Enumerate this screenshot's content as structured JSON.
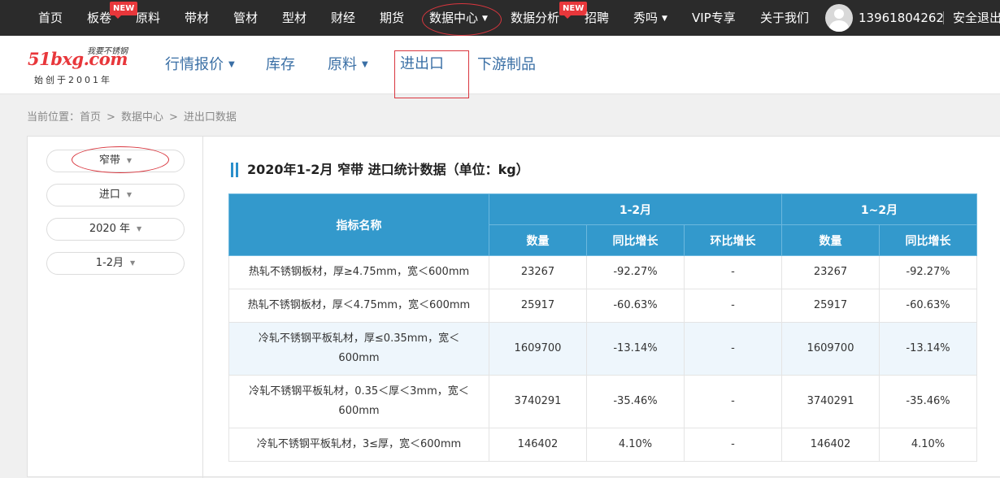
{
  "topnav": {
    "items": [
      {
        "label": "首页"
      },
      {
        "label": "板卷",
        "badge": "NEW"
      },
      {
        "label": "原料"
      },
      {
        "label": "带材"
      },
      {
        "label": "管材"
      },
      {
        "label": "型材"
      },
      {
        "label": "财经"
      },
      {
        "label": "期货"
      },
      {
        "label": "数据中心"
      },
      {
        "label": "数据分析",
        "badge": "NEW"
      },
      {
        "label": "招聘"
      },
      {
        "label": "秀吗"
      },
      {
        "label": "VIP专享"
      },
      {
        "label": "关于我们"
      }
    ],
    "user_phone": "13961804262",
    "security_exit": "安全退出"
  },
  "logo": {
    "brand": "51bxg.com",
    "slogan": "我要不锈钢",
    "since": "始创于2001年"
  },
  "subnav": {
    "items": [
      {
        "label": "行情报价"
      },
      {
        "label": "库存"
      },
      {
        "label": "原料"
      },
      {
        "label": "进出口"
      },
      {
        "label": "下游制品"
      }
    ]
  },
  "breadcrumb": {
    "prefix": "当前位置：",
    "items": [
      "首页",
      "数据中心",
      "进出口数据"
    ],
    "separator": ">"
  },
  "filters": {
    "product": "窄带",
    "direction": "进口",
    "year": "2020 年",
    "period": "1-2月"
  },
  "table": {
    "title": "2020年1-2月 窄带 进口统计数据（单位：kg）",
    "header": {
      "indicator": "指标名称",
      "group1": "1-2月",
      "group2": "1~2月",
      "sub": [
        "数量",
        "同比增长",
        "环比增长",
        "数量",
        "同比增长"
      ]
    },
    "rows": [
      {
        "name": "热轧不锈钢板材，厚≥4.75mm，宽＜600mm",
        "v": [
          "23267",
          "-92.27%",
          "-",
          "23267",
          "-92.27%"
        ]
      },
      {
        "name": "热轧不锈钢板材，厚＜4.75mm，宽＜600mm",
        "v": [
          "25917",
          "-60.63%",
          "-",
          "25917",
          "-60.63%"
        ]
      },
      {
        "name": "冷轧不锈钢平板轧材，厚≤0.35mm，宽＜600mm",
        "v": [
          "1609700",
          "-13.14%",
          "-",
          "1609700",
          "-13.14%"
        ]
      },
      {
        "name": "冷轧不锈钢平板轧材，0.35＜厚＜3mm，宽＜600mm",
        "v": [
          "3740291",
          "-35.46%",
          "-",
          "3740291",
          "-35.46%"
        ]
      },
      {
        "name": "冷轧不锈钢平板轧材，3≤厚，宽＜600mm",
        "v": [
          "146402",
          "4.10%",
          "-",
          "146402",
          "4.10%"
        ]
      }
    ]
  },
  "colors": {
    "topnav_bg": "#2b2b2b",
    "badge": "#e8373b",
    "link_blue": "#3a6fa5",
    "table_header": "#3399cc",
    "annotation_red": "#d9363e"
  }
}
